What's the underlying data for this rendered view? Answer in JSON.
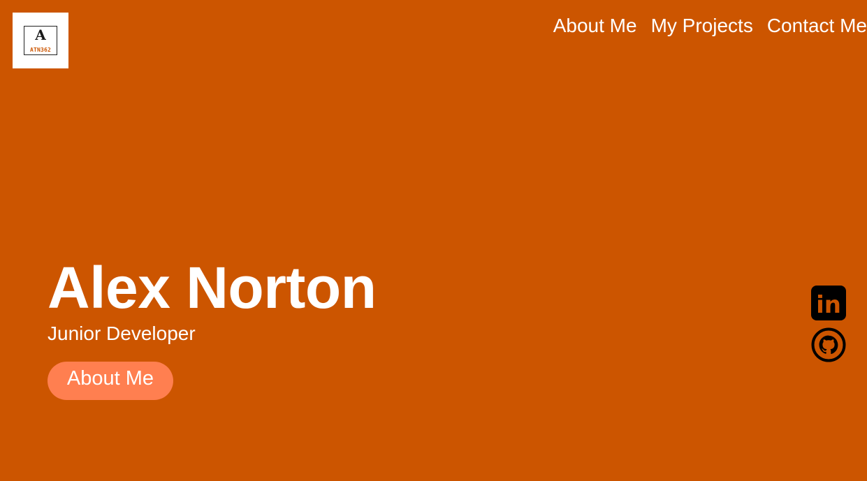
{
  "logo": {
    "glyph": "A",
    "text": "ATN362"
  },
  "nav": {
    "items": [
      {
        "label": "About Me"
      },
      {
        "label": "My Projects"
      },
      {
        "label": "Contact Me"
      }
    ]
  },
  "hero": {
    "name": "Alex Norton",
    "role": "Junior Developer",
    "button_label": "About Me"
  },
  "social": {
    "items": [
      {
        "icon": "linkedin-icon",
        "glyph": "in"
      },
      {
        "icon": "github-icon"
      }
    ]
  },
  "colors": {
    "background": "#cc5500",
    "button": "#ff7f50",
    "text": "#ffffff",
    "icon": "#000000"
  }
}
